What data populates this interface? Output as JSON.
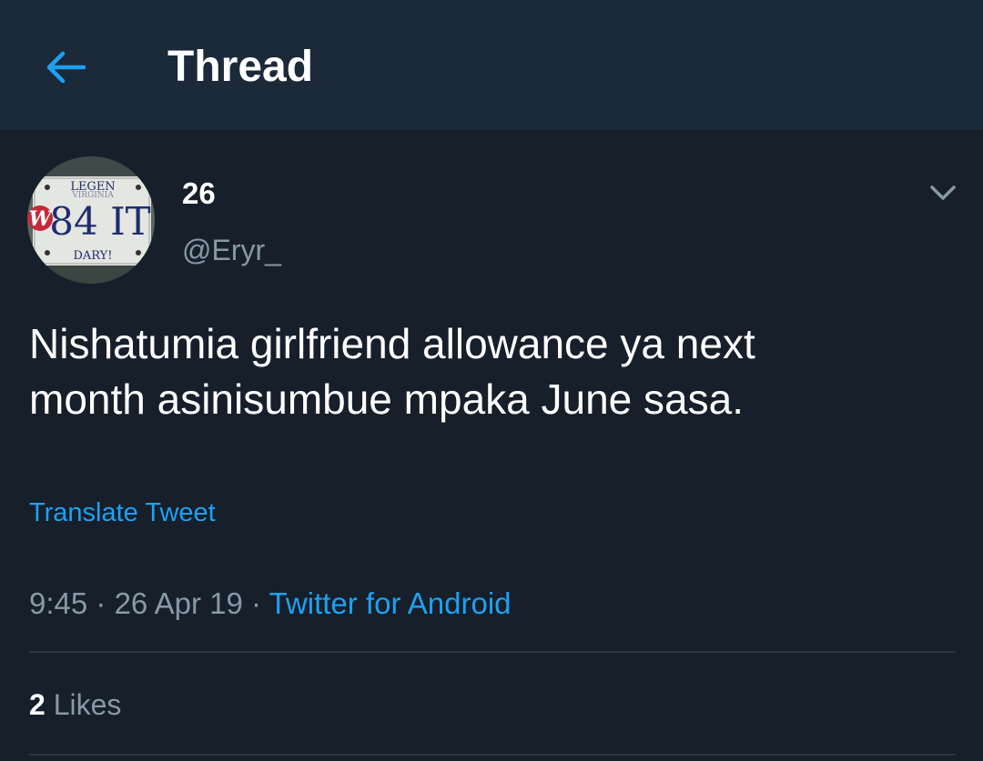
{
  "header": {
    "back_icon": "arrow-left-icon",
    "title": "Thread"
  },
  "tweet": {
    "author": {
      "display_name": "26",
      "handle": "@Eryr_",
      "avatar": {
        "plate_top": "LEGEN",
        "plate_state": "VIRGINIA",
        "plate_number": "84 IT",
        "plate_bottom": "DARY!"
      }
    },
    "caret_icon": "chevron-down-icon",
    "text": "Nishatumia girlfriend allowance ya next\nmonth asinisumbue mpaka June sasa.",
    "translate_label": "Translate Tweet",
    "meta": {
      "time": "9:45",
      "separator": " · ",
      "date": "26 Apr 19",
      "source": "Twitter for Android"
    },
    "likes": {
      "count": "2",
      "label": "Likes"
    }
  },
  "colors": {
    "background": "#161f2a",
    "header": "#1c2939",
    "accent": "#1da1f2",
    "secondary_text": "#8899a6",
    "divider": "#2a3744"
  }
}
